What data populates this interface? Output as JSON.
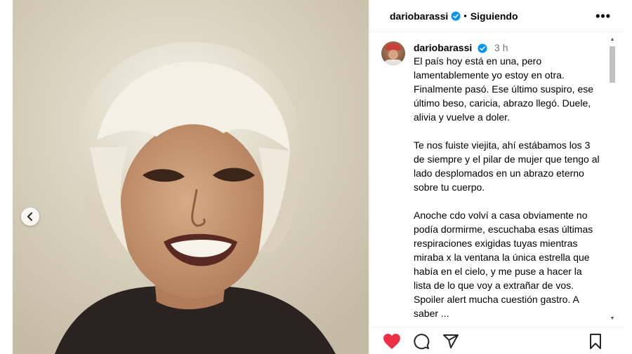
{
  "post": {
    "author": "dariobarassi",
    "follow_status": "Siguiendo",
    "separator": "•",
    "more_label": "•••",
    "timestamp": "3 h",
    "caption_paragraphs": [
      "El país hoy está en una, pero lamentablemente yo estoy en otra. Finalmente pasó. Ese último suspiro, ese último beso, caricia, abrazo llegó. Duele, alivia y vuelve a doler.",
      "Te nos fuiste viejita, ahí estábamos los 3 de siempre y el pilar de mujer que tengo al lado desplomados en un abrazo eterno sobre tu cuerpo.",
      "Anoche cdo volví a casa obviamente no podía dormirme, escuchaba esas últimas respiraciones exigidas tuyas mientras miraba x la ventana la única estrella que había en el cielo, y me puse a hacer la lista de lo que voy a extrañar de vos. Spoiler alert mucha cuestión gastro. A saber ..."
    ],
    "liked": true,
    "colors": {
      "like_red": "#ed2f48",
      "verified_blue": "#0095f6",
      "secondary_text": "#737373"
    },
    "icons": [
      "verified-badge-icon",
      "chevron-left-icon",
      "heart-icon",
      "comment-icon",
      "share-icon",
      "bookmark-icon"
    ]
  }
}
